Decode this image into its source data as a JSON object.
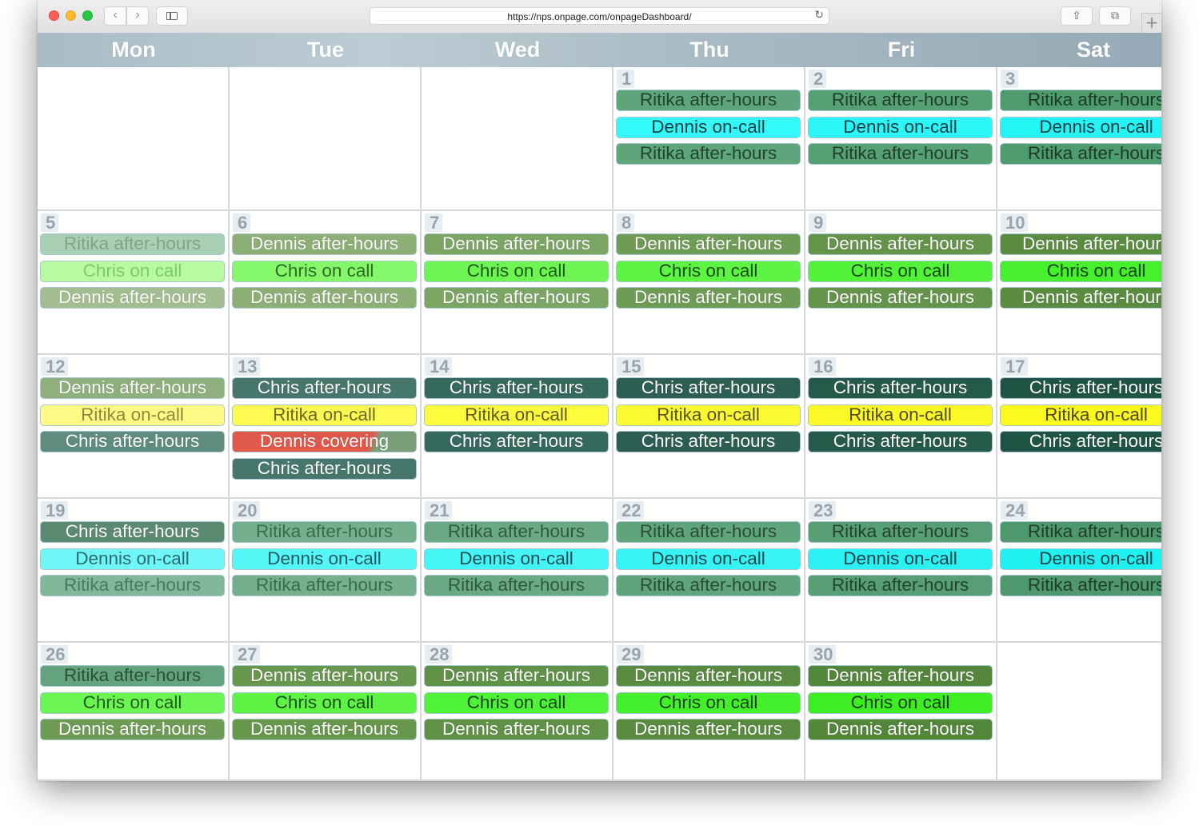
{
  "browser": {
    "url": "https://nps.onpage.com/onpageDashboard/",
    "back_icon": "‹",
    "forward_icon": "›",
    "reload_icon": "↻",
    "share_icon": "⇪",
    "tabs_icon": "⧉",
    "new_tab_icon": "+"
  },
  "calendar": {
    "days": [
      "Mon",
      "Tue",
      "Wed",
      "Thu",
      "Fri",
      "Sat"
    ],
    "weeks": [
      [
        {
          "day": "",
          "events": []
        },
        {
          "day": "",
          "events": []
        },
        {
          "day": "",
          "events": []
        },
        {
          "day": "1",
          "events": [
            {
              "label": "Ritika after-hours",
              "bg": "#5ea57b",
              "color": "#22442f"
            },
            {
              "label": "Dennis on-call",
              "bg": "#34f9f9",
              "color": "#0f3f47"
            },
            {
              "label": "Ritika after-hours",
              "bg": "#5ea57b",
              "color": "#22442f"
            }
          ]
        },
        {
          "day": "2",
          "events": [
            {
              "label": "Ritika after-hours",
              "bg": "#56a174",
              "color": "#1f3d2b"
            },
            {
              "label": "Dennis on-call",
              "bg": "#2cf7f7",
              "color": "#0f3f47"
            },
            {
              "label": "Ritika after-hours",
              "bg": "#56a174",
              "color": "#1f3d2b"
            }
          ]
        },
        {
          "day": "3",
          "events": [
            {
              "label": "Ritika after-hours",
              "bg": "#4e9b6d",
              "color": "#1d3928"
            },
            {
              "label": "Dennis on-call",
              "bg": "#24f4f4",
              "color": "#0f3f47"
            },
            {
              "label": "Ritika after-hours",
              "bg": "#4e9b6d",
              "color": "#1d3928"
            }
          ]
        }
      ],
      [
        {
          "day": "5",
          "events": [
            {
              "label": "Ritika after-hours",
              "bg": "#a9cfb4",
              "color": "#7ea58c"
            },
            {
              "label": "Chris on call",
              "bg": "#b6fba2",
              "color": "#7fc86a"
            },
            {
              "label": "Dennis after-hours",
              "bg": "#a2bd8f",
              "color": "#ffffff"
            }
          ]
        },
        {
          "day": "6",
          "events": [
            {
              "label": "Dennis after-hours",
              "bg": "#8daf76",
              "color": "#ffffff"
            },
            {
              "label": "Chris on call",
              "bg": "#84f86a",
              "color": "#2e6b22"
            },
            {
              "label": "Dennis after-hours",
              "bg": "#8daf76",
              "color": "#ffffff"
            }
          ]
        },
        {
          "day": "7",
          "events": [
            {
              "label": "Dennis after-hours",
              "bg": "#7ba562",
              "color": "#ffffff"
            },
            {
              "label": "Chris on call",
              "bg": "#6ef553",
              "color": "#1f5c15"
            },
            {
              "label": "Dennis after-hours",
              "bg": "#7ba562",
              "color": "#ffffff"
            }
          ]
        },
        {
          "day": "8",
          "events": [
            {
              "label": "Dennis after-hours",
              "bg": "#6e9c55",
              "color": "#ffffff"
            },
            {
              "label": "Chris on call",
              "bg": "#5ef444",
              "color": "#174f10"
            },
            {
              "label": "Dennis after-hours",
              "bg": "#6e9c55",
              "color": "#ffffff"
            }
          ]
        },
        {
          "day": "9",
          "events": [
            {
              "label": "Dennis after-hours",
              "bg": "#64944a",
              "color": "#ffffff"
            },
            {
              "label": "Chris on call",
              "bg": "#52f238",
              "color": "#12480b"
            },
            {
              "label": "Dennis after-hours",
              "bg": "#64944a",
              "color": "#ffffff"
            }
          ]
        },
        {
          "day": "10",
          "events": [
            {
              "label": "Dennis after-hours",
              "bg": "#5a8c40",
              "color": "#ffffff"
            },
            {
              "label": "Chris on call",
              "bg": "#46f02c",
              "color": "#0f420a"
            },
            {
              "label": "Dennis after-hours",
              "bg": "#5a8c40",
              "color": "#ffffff"
            }
          ]
        }
      ],
      [
        {
          "day": "12",
          "events": [
            {
              "label": "Dennis after-hours",
              "bg": "#8fb07d",
              "color": "#ffffff"
            },
            {
              "label": "Ritika on-call",
              "bg": "#fdfc86",
              "color": "#8c8a3a"
            },
            {
              "label": "Chris after-hours",
              "bg": "#5f8c7c",
              "color": "#ffffff"
            }
          ]
        },
        {
          "day": "13",
          "events": [
            {
              "label": "Chris after-hours",
              "bg": "#47776a",
              "color": "#ffffff"
            },
            {
              "label": "Ritika on-call",
              "bg": "#fdfb52",
              "color": "#6b6920"
            },
            {
              "label": "Dennis covering",
              "bg": "linear-gradient(110deg,#e0584a 0%,#e0584a 74%,#7a9e78 78%,#7a9e78 100%)",
              "color": "#ffffff"
            },
            {
              "label": "Chris after-hours",
              "bg": "#47776a",
              "color": "#ffffff"
            }
          ]
        },
        {
          "day": "14",
          "events": [
            {
              "label": "Chris after-hours",
              "bg": "#35695b",
              "color": "#ffffff"
            },
            {
              "label": "Ritika on-call",
              "bg": "#fdfb3c",
              "color": "#5e5c18"
            },
            {
              "label": "Chris after-hours",
              "bg": "#35695b",
              "color": "#ffffff"
            }
          ]
        },
        {
          "day": "15",
          "events": [
            {
              "label": "Chris after-hours",
              "bg": "#2c5f51",
              "color": "#ffffff"
            },
            {
              "label": "Ritika on-call",
              "bg": "#fcfa30",
              "color": "#575512"
            },
            {
              "label": "Chris after-hours",
              "bg": "#2c5f51",
              "color": "#ffffff"
            }
          ]
        },
        {
          "day": "16",
          "events": [
            {
              "label": "Chris after-hours",
              "bg": "#255a4b",
              "color": "#ffffff"
            },
            {
              "label": "Ritika on-call",
              "bg": "#fcf926",
              "color": "#4f4d0e"
            },
            {
              "label": "Chris after-hours",
              "bg": "#255a4b",
              "color": "#ffffff"
            }
          ]
        },
        {
          "day": "17",
          "events": [
            {
              "label": "Chris after-hours",
              "bg": "#1f5445",
              "color": "#ffffff"
            },
            {
              "label": "Ritika on-call",
              "bg": "#fcf91c",
              "color": "#49470a"
            },
            {
              "label": "Chris after-hours",
              "bg": "#1f5445",
              "color": "#ffffff"
            }
          ]
        }
      ],
      [
        {
          "day": "19",
          "events": [
            {
              "label": "Chris after-hours",
              "bg": "#5b8a72",
              "color": "#ffffff"
            },
            {
              "label": "Dennis on-call",
              "bg": "#6ff7f7",
              "color": "#2a6b72"
            },
            {
              "label": "Ritika after-hours",
              "bg": "#82b79a",
              "color": "#4a7a5d"
            }
          ]
        },
        {
          "day": "20",
          "events": [
            {
              "label": "Ritika after-hours",
              "bg": "#74b08e",
              "color": "#3b6b4e"
            },
            {
              "label": "Dennis on-call",
              "bg": "#55f6f6",
              "color": "#1f5a61"
            },
            {
              "label": "Ritika after-hours",
              "bg": "#74b08e",
              "color": "#3b6b4e"
            }
          ]
        },
        {
          "day": "21",
          "events": [
            {
              "label": "Ritika after-hours",
              "bg": "#69a984",
              "color": "#30593f"
            },
            {
              "label": "Dennis on-call",
              "bg": "#45f5f5",
              "color": "#174e55"
            },
            {
              "label": "Ritika after-hours",
              "bg": "#69a984",
              "color": "#30593f"
            }
          ]
        },
        {
          "day": "22",
          "events": [
            {
              "label": "Ritika after-hours",
              "bg": "#60a47c",
              "color": "#294d36"
            },
            {
              "label": "Dennis on-call",
              "bg": "#36f4f4",
              "color": "#124750"
            },
            {
              "label": "Ritika after-hours",
              "bg": "#60a47c",
              "color": "#294d36"
            }
          ]
        },
        {
          "day": "23",
          "events": [
            {
              "label": "Ritika after-hours",
              "bg": "#579e74",
              "color": "#22432f"
            },
            {
              "label": "Dennis on-call",
              "bg": "#2af2f2",
              "color": "#0f424a"
            },
            {
              "label": "Ritika after-hours",
              "bg": "#579e74",
              "color": "#22432f"
            }
          ]
        },
        {
          "day": "24",
          "events": [
            {
              "label": "Ritika after-hours",
              "bg": "#4f986d",
              "color": "#1e3d2a"
            },
            {
              "label": "Dennis on-call",
              "bg": "#1ff0f0",
              "color": "#0d3d45"
            },
            {
              "label": "Ritika after-hours",
              "bg": "#4f986d",
              "color": "#1e3d2a"
            }
          ]
        }
      ],
      [
        {
          "day": "26",
          "events": [
            {
              "label": "Ritika after-hours",
              "bg": "#63a37f",
              "color": "#2c5038"
            },
            {
              "label": "Chris on call",
              "bg": "#6cf652",
              "color": "#1f5c15"
            },
            {
              "label": "Dennis after-hours",
              "bg": "#6e9c55",
              "color": "#ffffff"
            }
          ]
        },
        {
          "day": "27",
          "events": [
            {
              "label": "Dennis after-hours",
              "bg": "#67974d",
              "color": "#ffffff"
            },
            {
              "label": "Chris on call",
              "bg": "#5df443",
              "color": "#174f10"
            },
            {
              "label": "Dennis after-hours",
              "bg": "#67974d",
              "color": "#ffffff"
            }
          ]
        },
        {
          "day": "28",
          "events": [
            {
              "label": "Dennis after-hours",
              "bg": "#5f9146",
              "color": "#ffffff"
            },
            {
              "label": "Chris on call",
              "bg": "#4ef236",
              "color": "#12480b"
            },
            {
              "label": "Dennis after-hours",
              "bg": "#5f9146",
              "color": "#ffffff"
            }
          ]
        },
        {
          "day": "29",
          "events": [
            {
              "label": "Dennis after-hours",
              "bg": "#588b3f",
              "color": "#ffffff"
            },
            {
              "label": "Chris on call",
              "bg": "#44f02b",
              "color": "#0f420a"
            },
            {
              "label": "Dennis after-hours",
              "bg": "#588b3f",
              "color": "#ffffff"
            }
          ]
        },
        {
          "day": "30",
          "events": [
            {
              "label": "Dennis after-hours",
              "bg": "#528639",
              "color": "#ffffff"
            },
            {
              "label": "Chris on call",
              "bg": "#3cee22",
              "color": "#0d3d08"
            },
            {
              "label": "Dennis after-hours",
              "bg": "#528639",
              "color": "#ffffff"
            }
          ]
        },
        {
          "day": "",
          "events": []
        }
      ]
    ]
  }
}
